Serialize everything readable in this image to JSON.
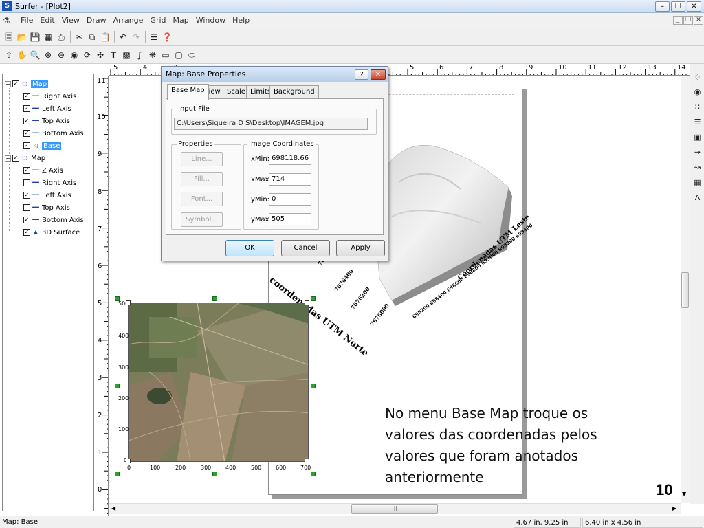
{
  "window": {
    "title": "Surfer - [Plot2]",
    "icon": "surfer-app-icon",
    "controls": [
      "minimize",
      "restore",
      "close"
    ]
  },
  "menubar": {
    "items": [
      "File",
      "Edit",
      "View",
      "Draw",
      "Arrange",
      "Grid",
      "Map",
      "Window",
      "Help"
    ]
  },
  "toolbar1": {
    "icons": [
      "new-icon",
      "open-icon",
      "save-icon",
      "worksheet-icon",
      "print-icon",
      "cut-icon",
      "copy-icon",
      "paste-icon",
      "undo-icon",
      "redo-icon",
      "object-manager-icon",
      "help-pointer-icon"
    ]
  },
  "toolbar2": {
    "icons": [
      "select-arrow-icon",
      "pan-hand-icon",
      "zoom-rect-icon",
      "zoom-in-icon",
      "zoom-out-icon",
      "zoom-page-icon",
      "rotate-icon",
      "move-icon",
      "text-icon",
      "polygon-icon",
      "polyline-icon",
      "symbol-icon",
      "rectangle-icon",
      "rounded-rect-icon",
      "ellipse-icon"
    ]
  },
  "object_tree": {
    "items": [
      {
        "label": "Map",
        "type": "map",
        "checked": true,
        "expanded": true,
        "selected": true,
        "level": 0
      },
      {
        "label": "Right Axis",
        "type": "axis",
        "checked": true,
        "level": 1
      },
      {
        "label": "Left Axis",
        "type": "axis",
        "checked": true,
        "level": 1
      },
      {
        "label": "Top Axis",
        "type": "axis",
        "checked": true,
        "level": 1
      },
      {
        "label": "Bottom Axis",
        "type": "axis",
        "checked": true,
        "level": 1
      },
      {
        "label": "Base",
        "type": "base",
        "checked": true,
        "selected": true,
        "level": 1
      },
      {
        "label": "Map",
        "type": "map",
        "checked": true,
        "expanded": true,
        "level": 0
      },
      {
        "label": "Z Axis",
        "type": "axis",
        "checked": true,
        "level": 1
      },
      {
        "label": "Right Axis",
        "type": "axis",
        "checked": false,
        "level": 1
      },
      {
        "label": "Left Axis",
        "type": "axis",
        "checked": true,
        "level": 1
      },
      {
        "label": "Top Axis",
        "type": "axis",
        "checked": false,
        "level": 1
      },
      {
        "label": "Bottom Axis",
        "type": "axis",
        "checked": true,
        "level": 1
      },
      {
        "label": "3D Surface",
        "type": "surface",
        "checked": true,
        "level": 1
      }
    ]
  },
  "rulers": {
    "horizontal_labels": [
      "5",
      "4",
      "3",
      "2",
      "1",
      "0",
      "1",
      "2",
      "3",
      "4",
      "5",
      "6",
      "7",
      "8",
      "9",
      "10",
      "11",
      "12",
      "13",
      "14"
    ],
    "vertical_labels": [
      "11",
      "10",
      "9",
      "8",
      "7",
      "6",
      "5",
      "4",
      "3",
      "2",
      "1",
      "0"
    ]
  },
  "dialog": {
    "title": "Map: Base Properties",
    "help_label": "?",
    "close_label": "✕",
    "tabs": [
      "Base Map",
      "View",
      "Scale",
      "Limits",
      "Background"
    ],
    "active_tab": "Base Map",
    "input_file": {
      "group_label": "Input File",
      "path": "C:\\Users\\Siqueira D S\\Desktop\\IMAGEM.jpg"
    },
    "properties": {
      "group_label": "Properties",
      "buttons": [
        "Line...",
        "Fill...",
        "Font...",
        "Symbol..."
      ]
    },
    "image_coordinates": {
      "group_label": "Image Coordinates",
      "fields": [
        {
          "label": "xMin:",
          "value": "698118.66"
        },
        {
          "label": "xMax:",
          "value": "714"
        },
        {
          "label": "yMin:",
          "value": "0"
        },
        {
          "label": "yMax:",
          "value": "505"
        }
      ]
    },
    "buttons": {
      "ok": "OK",
      "cancel": "Cancel",
      "apply": "Apply"
    }
  },
  "surface_labels": {
    "y_title": "coordenadas UTM Norte",
    "x_title": "Coordenadas UTM Leste",
    "y_ticks": [
      "7676600",
      "7676400",
      "7676200",
      "7676000"
    ],
    "x_ticks": "698200 698400 698600 698800 699000 699200 699400"
  },
  "base_map": {
    "y_ticks": [
      "500",
      "400",
      "300",
      "200",
      "100",
      "0"
    ],
    "x_ticks": [
      "0",
      "100",
      "200",
      "300",
      "400",
      "500",
      "600",
      "700"
    ]
  },
  "slide": {
    "instruction": "No menu Base Map troque os valores das coordenadas pelos valores que foram anotados anteriormente",
    "number": "10"
  },
  "right_toolbar": {
    "icons": [
      "contour-map-icon",
      "base-map-icon",
      "post-map-icon",
      "classed-post-icon",
      "image-map-icon",
      "vector-map-icon",
      "surface-icon",
      "wireframe-icon",
      "3d-surface-icon"
    ]
  },
  "statusbar": {
    "selection": "Map: Base",
    "cursor_position": "4.67 in, 9.25 in",
    "object_size": "6.40 in x 4.56 in"
  }
}
